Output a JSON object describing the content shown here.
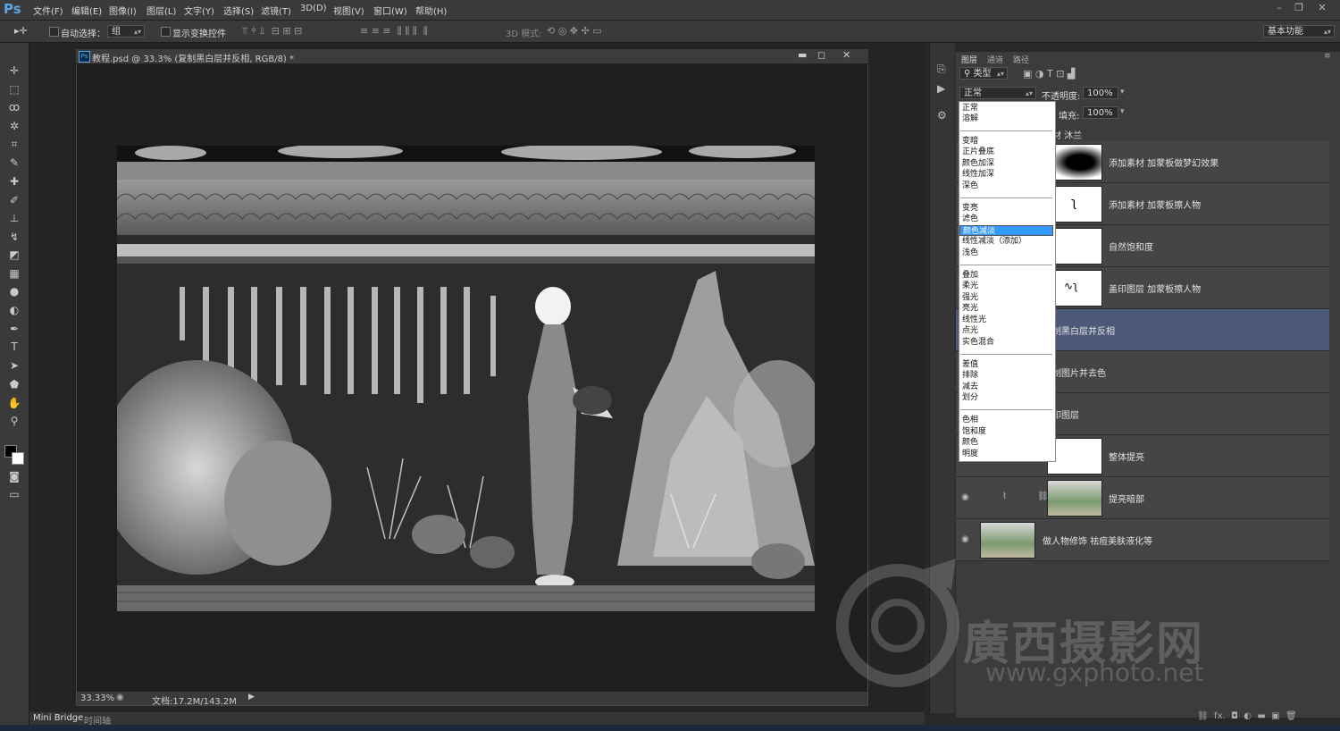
{
  "app": {
    "logo": "Ps"
  },
  "menu": [
    "文件(F)",
    "编辑(E)",
    "图像(I)",
    "图层(L)",
    "文字(Y)",
    "选择(S)",
    "滤镜(T)",
    "3D(D)",
    "视图(V)",
    "窗口(W)",
    "帮助(H)"
  ],
  "options_bar": {
    "auto_select_label": "自动选择：",
    "auto_select_value": "组",
    "show_transform_label": "显示变换控件",
    "mode_3d_label": "3D 模式:",
    "workspace_value": "基本功能"
  },
  "document": {
    "title": "教程.psd @ 33.3% (复制黑白层并反相, RGB/8) *",
    "zoom": "33.33%",
    "doc_size": "文档:17.2M/143.2M"
  },
  "bottom_tabs": [
    "Mini Bridge",
    "时间轴"
  ],
  "panel": {
    "tabs": [
      "图层",
      "通道",
      "路径"
    ],
    "filter_label": "类型",
    "blend_mode": "正常",
    "opacity_label": "不透明度:",
    "opacity_value": "100%",
    "fill_label": "填充:",
    "fill_value": "100%",
    "group_label": "材 沐兰"
  },
  "layers": [
    {
      "name": "添加素材  加蒙板做梦幻效果",
      "thumb": "dream"
    },
    {
      "name": "添加素材  加蒙板擦人物",
      "thumb": "figure"
    },
    {
      "name": "自然饱和度",
      "thumb": "white"
    },
    {
      "name": "盖印图层  加蒙板擦人物",
      "thumb": "figure2"
    },
    {
      "name": "制黑白层并反相",
      "thumb": "none",
      "selected": true
    },
    {
      "name": "制图片并去色",
      "thumb": "none"
    },
    {
      "name": "印图层",
      "thumb": "none"
    },
    {
      "name": "整体提亮",
      "thumb": "white"
    },
    {
      "name": "提亮暗部",
      "thumb": "photo"
    },
    {
      "name": "做人物修饰  祛痘美肤液化等",
      "thumb": "photo"
    }
  ],
  "blend_dropdown": {
    "groups": [
      [
        "正常",
        "溶解"
      ],
      [
        "变暗",
        "正片叠底",
        "颜色加深",
        "线性加深",
        "深色"
      ],
      [
        "变亮",
        "滤色",
        "颜色减淡",
        "线性减淡（添加）",
        "浅色"
      ],
      [
        "叠加",
        "柔光",
        "强光",
        "亮光",
        "线性光",
        "点光",
        "实色混合"
      ],
      [
        "差值",
        "排除",
        "减去",
        "划分"
      ],
      [
        "色相",
        "饱和度",
        "颜色",
        "明度"
      ]
    ],
    "selected": "颜色减淡"
  },
  "watermark": {
    "title": "廣西摄影网",
    "url": "www.gxphoto.net"
  },
  "colors": {
    "ui_bg": "#3a3a3a",
    "workspace": "#282828",
    "selection": "#3399ff",
    "layer_selected": "#4c5978"
  }
}
